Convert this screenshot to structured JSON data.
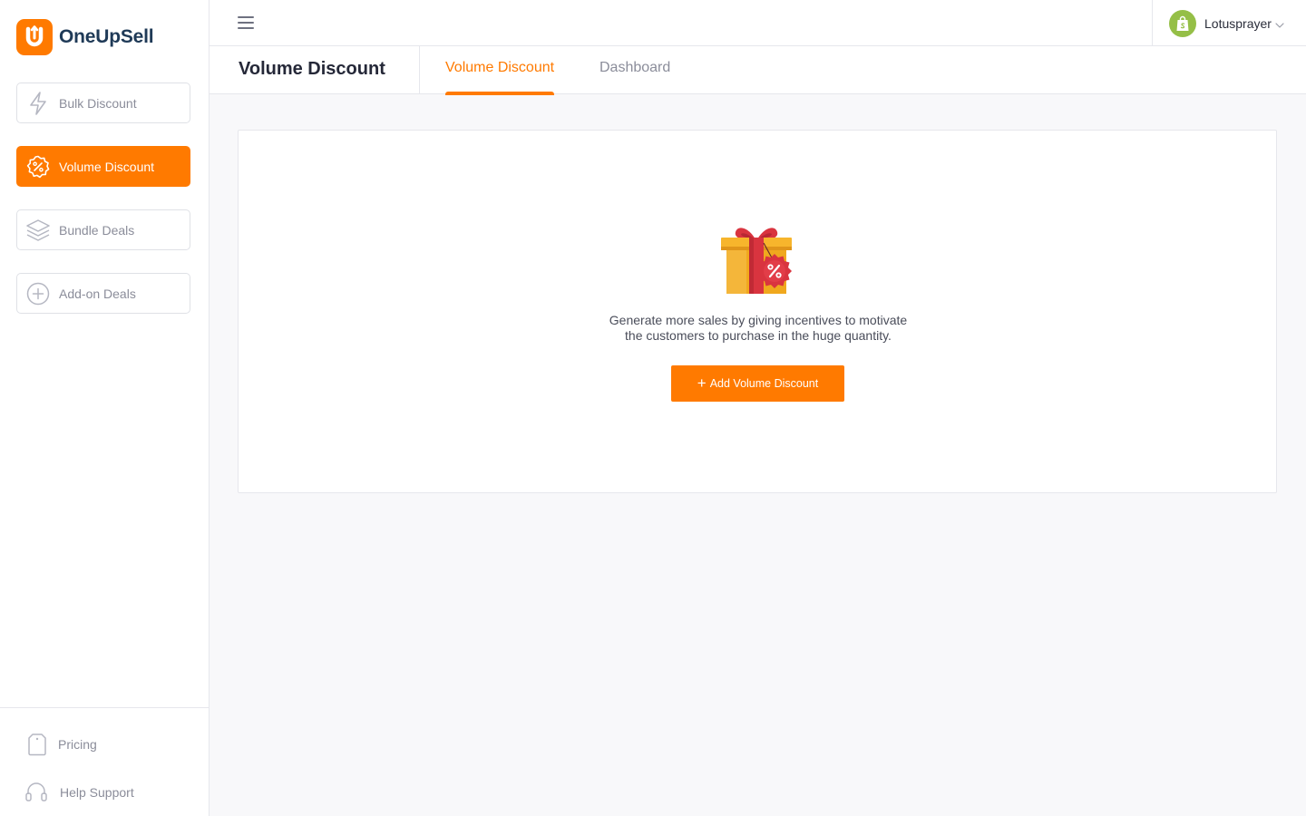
{
  "app": {
    "name": "OneUpSell"
  },
  "sidebar": {
    "items": [
      {
        "label": "Bulk Discount",
        "icon": "lightning-icon",
        "active": false
      },
      {
        "label": "Volume Discount",
        "icon": "discount-badge-icon",
        "active": true
      },
      {
        "label": "Bundle Deals",
        "icon": "layers-icon",
        "active": false
      },
      {
        "label": "Add-on Deals",
        "icon": "plus-circle-icon",
        "active": false
      }
    ],
    "bottom": [
      {
        "label": "Pricing",
        "icon": "price-tag-icon"
      },
      {
        "label": "Help Support",
        "icon": "headset-icon"
      }
    ]
  },
  "topbar": {
    "menu_icon": "hamburger-icon",
    "user": {
      "name": "Lotusprayer",
      "avatar_icon": "shopify-bag-icon"
    }
  },
  "header": {
    "title": "Volume Discount",
    "tabs": [
      {
        "label": "Volume Discount",
        "active": true
      },
      {
        "label": "Dashboard",
        "active": false
      }
    ]
  },
  "empty_state": {
    "illustration": "gift-discount-icon",
    "line1": "Generate more sales by giving incentives to motivate",
    "line2": "the customers to purchase in the huge quantity.",
    "button_label": "Add Volume Discount"
  },
  "colors": {
    "accent": "#ff7a00",
    "brand_text": "#1f3a57",
    "shopify_green": "#95bf47"
  }
}
